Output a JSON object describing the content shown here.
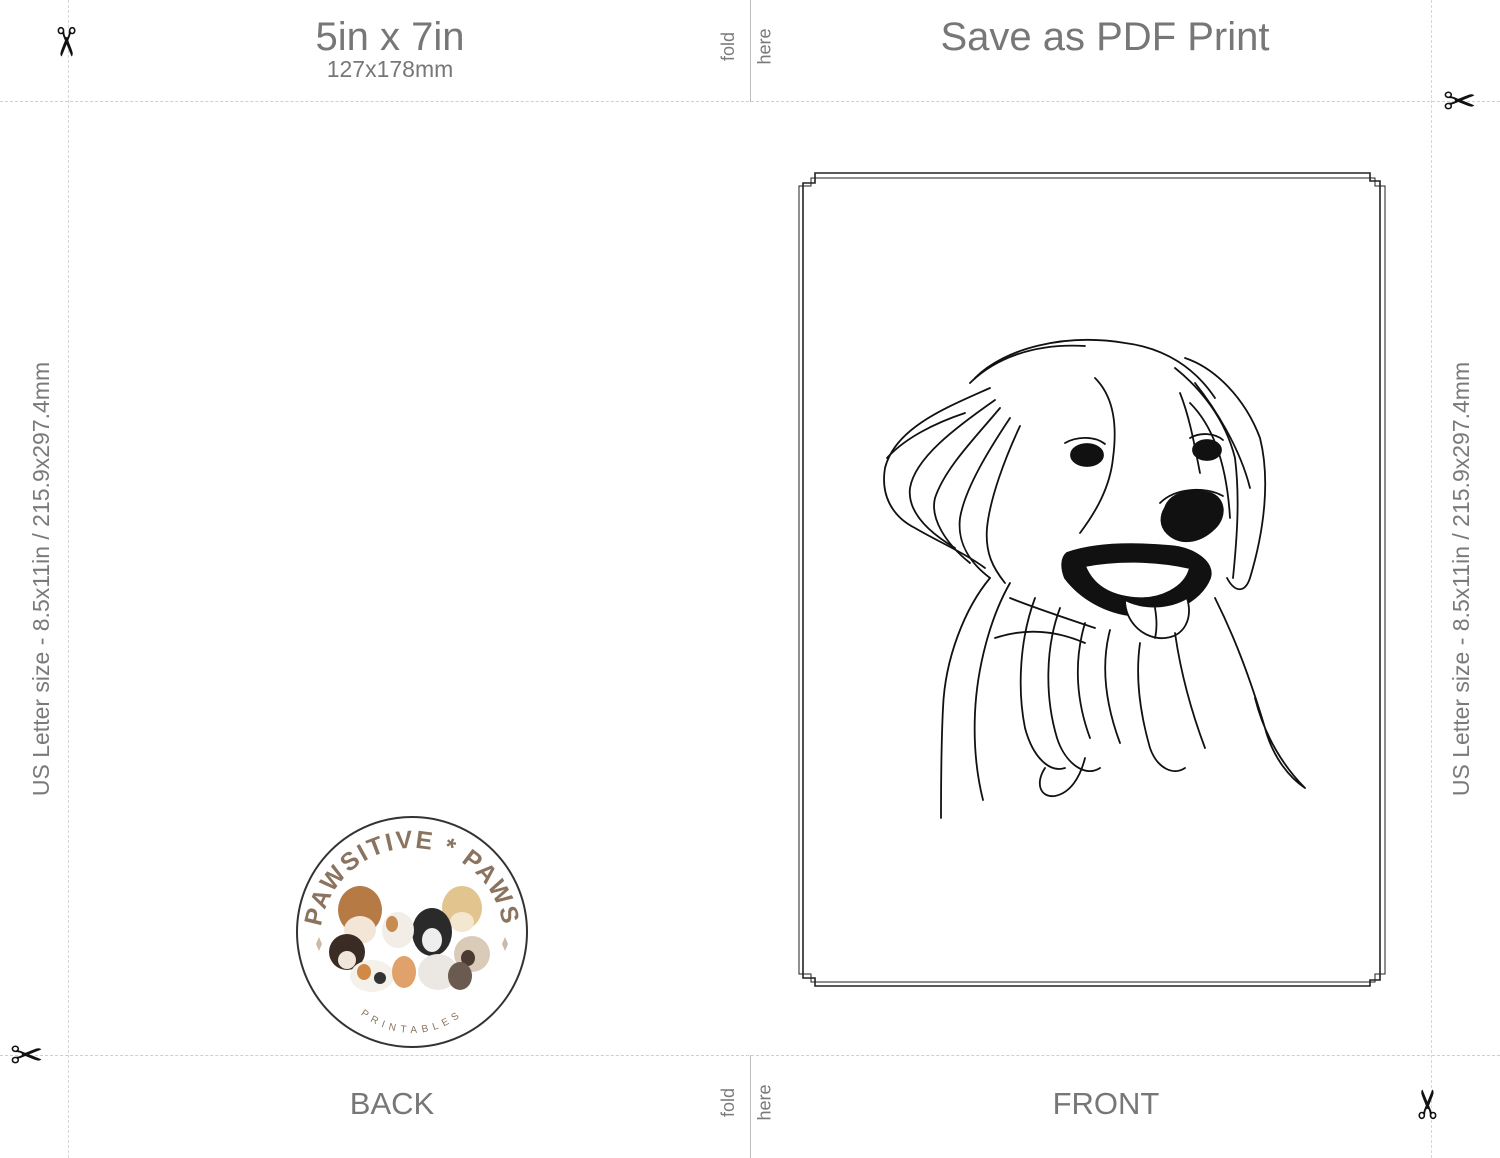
{
  "header": {
    "size_title": "5in x 7in",
    "size_sub": "127x178mm",
    "save_title": "Save as PDF Print"
  },
  "fold": {
    "word1": "fold",
    "word2": "here"
  },
  "panels": {
    "back_label": "BACK",
    "front_label": "FRONT"
  },
  "side_label": "US Letter size - 8.5x11in / 215.9x297.4mm",
  "logo": {
    "arc_text": "PAWSITIVE * PAWS",
    "sub_text": "PRINTABLES"
  },
  "icons": [
    "scissors-icon",
    "dog-line-art"
  ],
  "colors": {
    "text_gray": "#777777",
    "logo_brown": "#8a7460",
    "line_art": "#111111"
  }
}
